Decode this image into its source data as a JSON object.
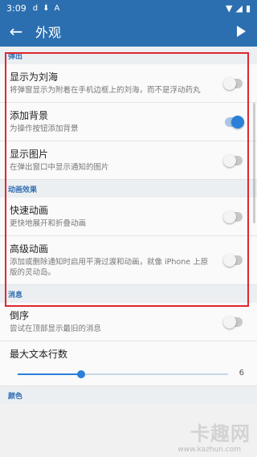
{
  "status_bar": {
    "time": "3:09",
    "icons": [
      "d-app-icon",
      "download-icon",
      "font-a-icon"
    ],
    "right_icons": [
      "wifi-icon",
      "signal-icon",
      "battery-icon"
    ]
  },
  "app_bar": {
    "title": "外观"
  },
  "sections": {
    "popup": {
      "header": "弹出",
      "items": [
        {
          "title": "显示为刘海",
          "subtitle": "将弹窗显示为附着在手机边框上的刘海，而不是浮动药丸",
          "on": false
        },
        {
          "title": "添加背景",
          "subtitle": "为操作按钮添加背景",
          "on": true
        },
        {
          "title": "显示图片",
          "subtitle": "在弹出窗口中显示通知的图片",
          "on": false
        }
      ]
    },
    "animation": {
      "header": "动画效果",
      "items": [
        {
          "title": "快速动画",
          "subtitle": "更快地展开和折叠动画",
          "on": false
        },
        {
          "title": "高级动画",
          "subtitle": "添加或删除通知时启用平滑过渡和动画，就像 iPhone 上原版的灵动岛。",
          "on": false
        }
      ]
    },
    "messages": {
      "header": "消息",
      "items": [
        {
          "title": "倒序",
          "subtitle": "尝试在顶部显示最旧的消息",
          "on": false
        }
      ],
      "max_lines": {
        "title": "最大文本行数",
        "value": "6",
        "fraction": 0.3
      }
    },
    "color": {
      "header": "颜色"
    }
  },
  "watermark": {
    "text": "卡趣网",
    "url": "www.kazhun.com"
  },
  "colors": {
    "accent": "#2b7fd8",
    "app_bar": "#2b6fb0",
    "highlight_box": "#e0262f"
  }
}
